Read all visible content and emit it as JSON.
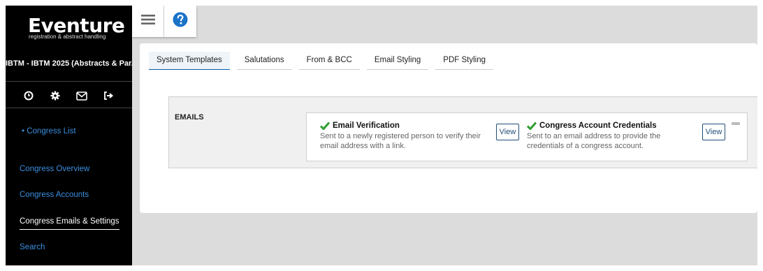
{
  "sidebar": {
    "logo_title": "Eventure",
    "logo_subtitle": "registration & abstract handling",
    "project_name": "IBTM - IBTM 2025 (Abstracts & Par...",
    "icons": [
      "clock-icon",
      "gear-icon",
      "envelope-icon",
      "sign-out-icon"
    ],
    "congress_list": "• Congress List",
    "nav": [
      {
        "label": "Congress Overview",
        "active": false
      },
      {
        "label": "Congress Accounts",
        "active": false
      },
      {
        "label": "Congress Emails & Settings",
        "active": true
      },
      {
        "label": "Search",
        "active": false
      }
    ]
  },
  "topbar": {
    "menu_icon": "hamburger-icon",
    "help_icon": "help-icon"
  },
  "tabs": [
    {
      "label": "System Templates",
      "active": true
    },
    {
      "label": "Salutations",
      "active": false
    },
    {
      "label": "From & BCC",
      "active": false
    },
    {
      "label": "Email Styling",
      "active": false
    },
    {
      "label": "PDF Styling",
      "active": false
    }
  ],
  "emails": {
    "section_label": "EMAILS",
    "items": [
      {
        "title": "Email Verification",
        "description_line1": "Sent to a newly registered person to verify their",
        "description_line2": "email address with a link.",
        "button": "View"
      },
      {
        "title": "Congress Account Credentials",
        "description_line1": "Sent to an email address to provide the",
        "description_line2": "credentials of a congress account.",
        "button": "View"
      }
    ]
  },
  "colors": {
    "accent": "#0b5cad",
    "link": "#3b8fe0",
    "check": "#2e9e2e",
    "help": "#1a73c8"
  }
}
